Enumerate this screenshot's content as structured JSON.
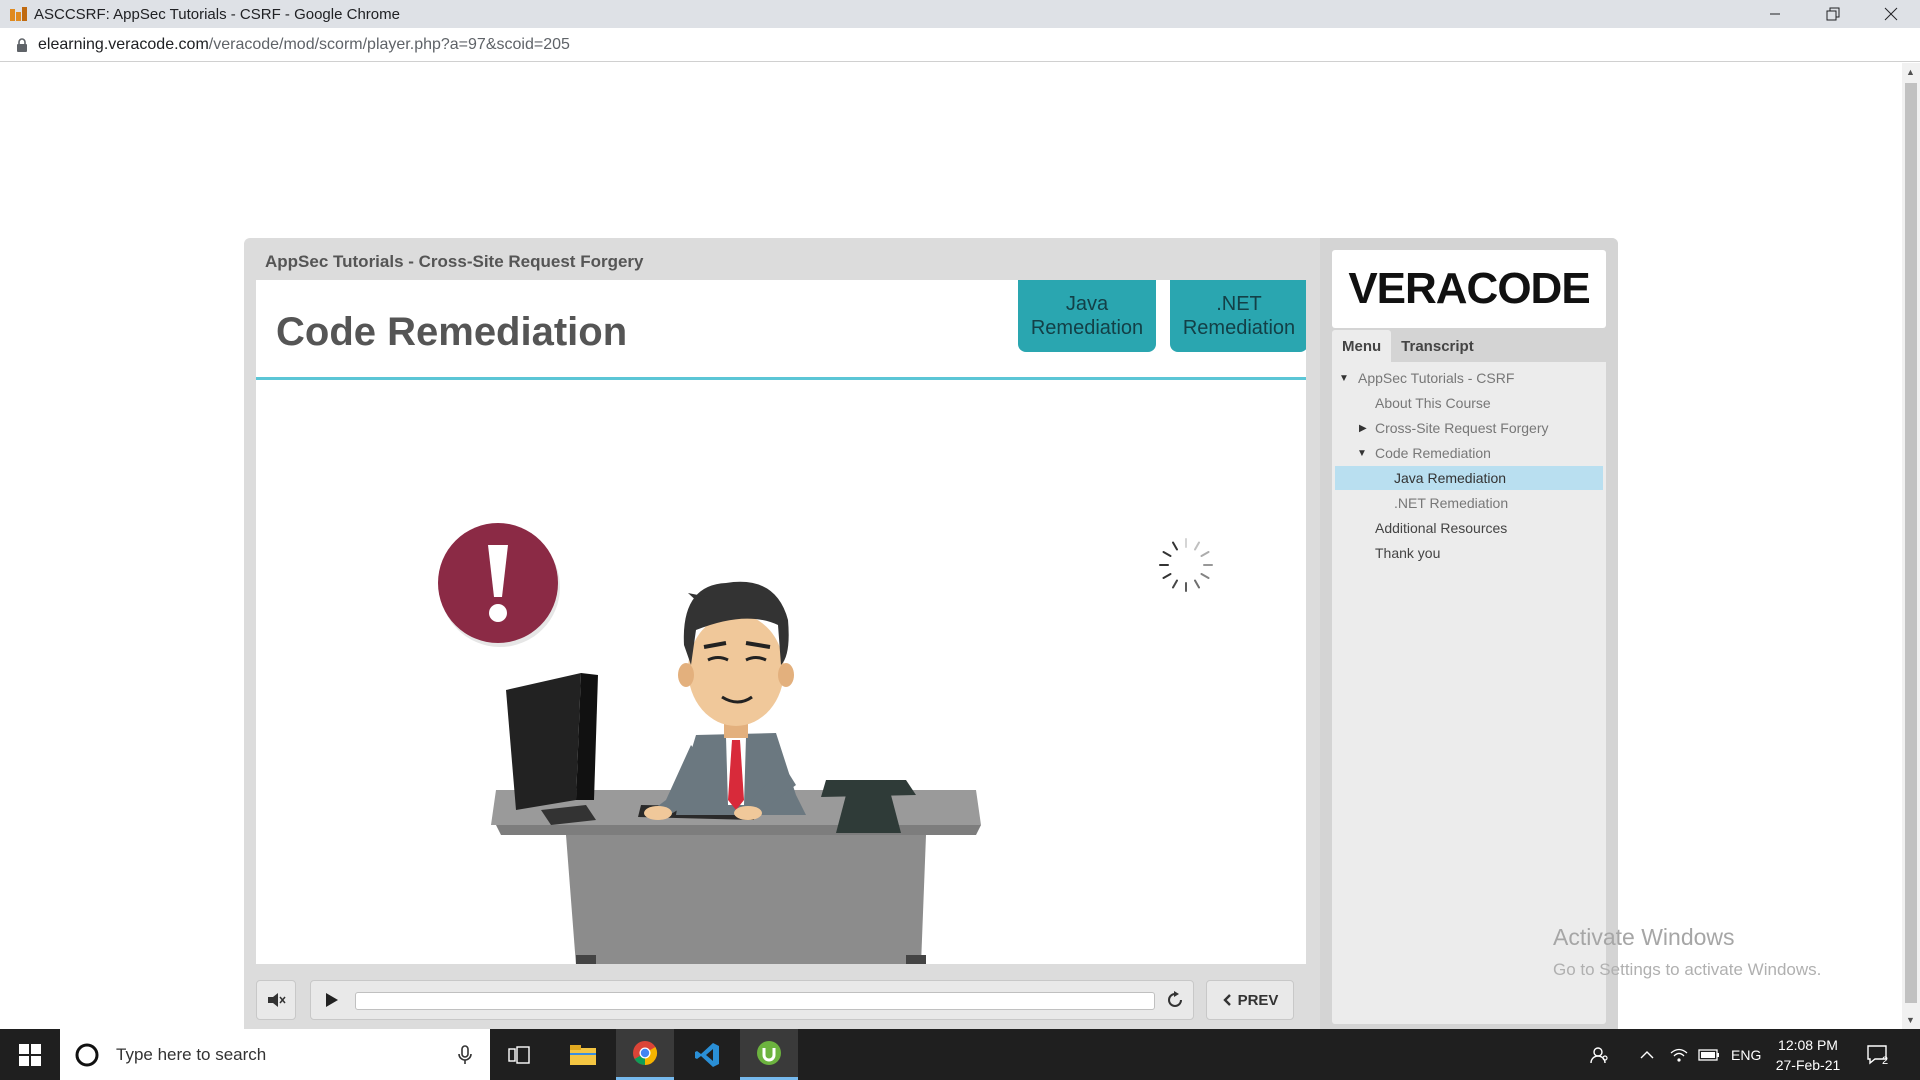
{
  "browser": {
    "window_title": "ASCCSRF: AppSec Tutorials - CSRF - Google Chrome",
    "url_host": "elearning.veracode.com",
    "url_path": "/veracode/mod/scorm/player.php?a=97&scoid=205"
  },
  "player": {
    "header": "AppSec Tutorials - Cross-Site Request Forgery",
    "slide_title": "Code Remediation",
    "buttons": {
      "java": "Java Remediation",
      "dotnet": ".NET Remediation"
    },
    "controls": {
      "prev_label": "PREV",
      "progress_fraction": 0.0
    }
  },
  "sidebar": {
    "logo": "VERACODE",
    "tabs": [
      {
        "label": "Menu"
      },
      {
        "label": "Transcript"
      }
    ],
    "menu": [
      {
        "label": "AppSec Tutorials - CSRF",
        "caret": "down"
      },
      {
        "label": "About This Course",
        "caret": ""
      },
      {
        "label": "Cross-Site Request Forgery",
        "caret": "right"
      },
      {
        "label": "Code Remediation",
        "caret": "down"
      },
      {
        "label": "Java Remediation",
        "caret": "",
        "selected": true
      },
      {
        "label": ".NET Remediation",
        "caret": ""
      },
      {
        "label": "Additional Resources",
        "caret": ""
      },
      {
        "label": "Thank you",
        "caret": ""
      }
    ]
  },
  "watermark": {
    "title": "Activate Windows",
    "subtitle": "Go to Settings to activate Windows."
  },
  "taskbar": {
    "search_placeholder": "Type here to search",
    "language": "ENG",
    "time": "12:08 PM",
    "date": "27-Feb-21",
    "notification_count": "2"
  },
  "colors": {
    "teal_button": "#2aa6b0",
    "accent_rule": "#5bc6d6",
    "selected_menu": "#b9dff0",
    "alert_red": "#8b2a45"
  }
}
